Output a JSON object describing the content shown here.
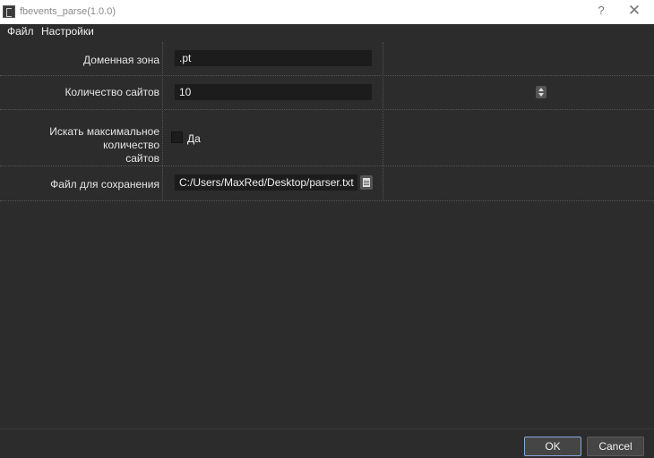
{
  "window": {
    "title": "fbevents_parse(1.0.0)",
    "help_glyph": "?",
    "close_glyph": "✕"
  },
  "menu": {
    "items": [
      "Файл",
      "Настройки"
    ]
  },
  "form": {
    "domain_label": "Доменная зона",
    "domain_value": ".pt",
    "count_label": "Количество сайтов",
    "count_value": "10",
    "max_label_line1": "Искать максимальное количество",
    "max_label_line2": "сайтов",
    "max_checked": false,
    "max_checkbox_label": "Да",
    "save_label": "Файл для сохранения",
    "save_value": "C:/Users/MaxRed/Desktop/parser.txt"
  },
  "buttons": {
    "ok": "OK",
    "cancel": "Cancel"
  },
  "icons": {
    "app": "app-icon",
    "browse": "document-icon",
    "spin_up": "arrow-up-icon",
    "spin_down": "arrow-down-icon"
  },
  "colors": {
    "background": "#2c2c2c",
    "field": "#1c1c1c",
    "titlebar": "#ffffff",
    "ok_border": "#8aa8d8"
  }
}
